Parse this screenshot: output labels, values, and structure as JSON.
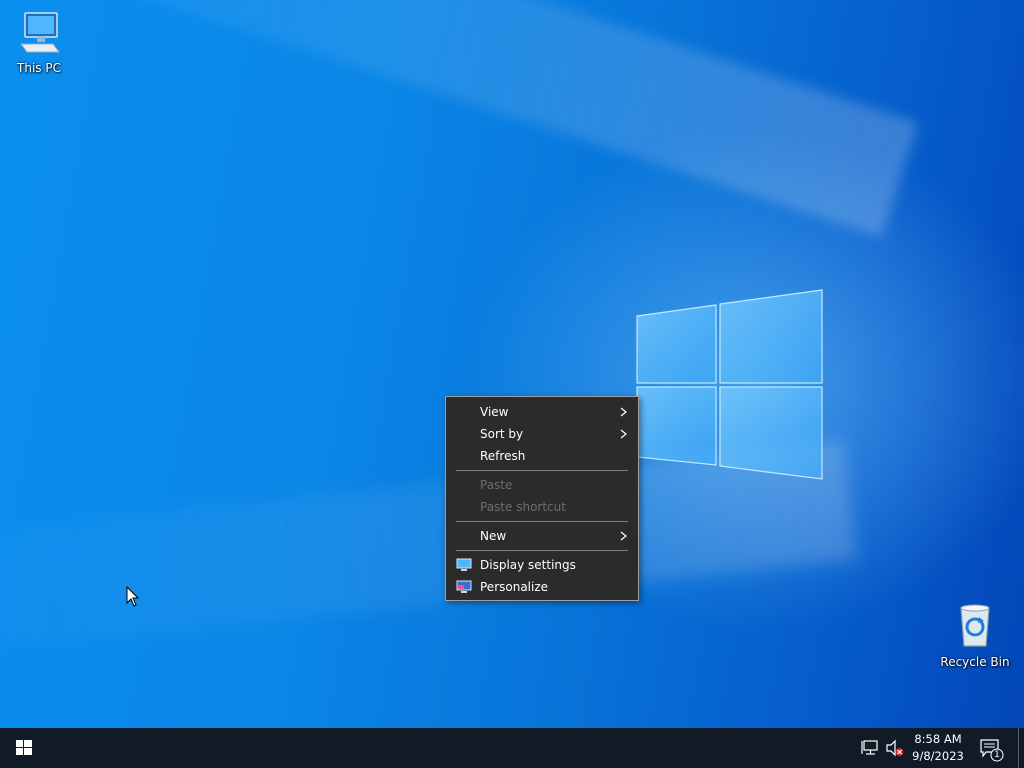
{
  "desktop": {
    "icons": [
      {
        "label": "This PC",
        "icon": "computer-icon"
      },
      {
        "label": "Recycle Bin",
        "icon": "recycle-bin-icon"
      }
    ]
  },
  "context_menu": {
    "items": {
      "view": "View",
      "sort_by": "Sort by",
      "refresh": "Refresh",
      "paste": "Paste",
      "paste_shortcut": "Paste shortcut",
      "new": "New",
      "display_settings": "Display settings",
      "personalize": "Personalize"
    },
    "disabled": [
      "Paste",
      "Paste shortcut"
    ]
  },
  "taskbar": {
    "start_icon": "windows-logo-icon",
    "tray": {
      "network_icon": "network-icon",
      "volume_icon": "volume-muted-icon",
      "time": "8:58 AM",
      "date": "9/8/2023",
      "notification_count": "1"
    }
  },
  "colors": {
    "accent": "#0a86e6",
    "taskbar": "#101b27",
    "menu_bg": "#2b2b2b",
    "disabled_text": "#6d6d6d"
  }
}
